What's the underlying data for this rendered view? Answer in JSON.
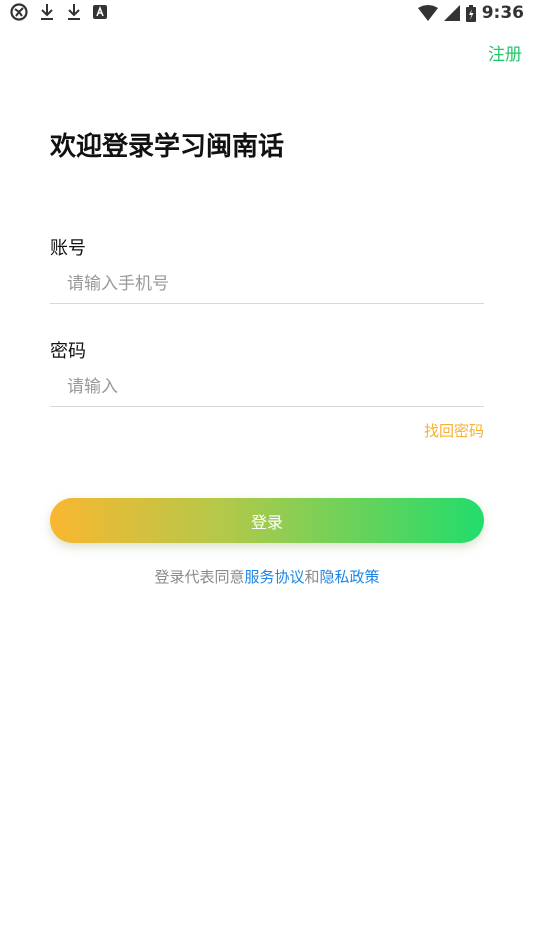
{
  "status_bar": {
    "time": "9:36",
    "left_icons": [
      "vpn-icon",
      "download-icon",
      "download-icon",
      "app-a-icon"
    ],
    "right_icons": [
      "wifi-icon",
      "signal-icon",
      "battery-charging-icon"
    ]
  },
  "header": {
    "register_label": "注册"
  },
  "main": {
    "title": "欢迎登录学习闽南话",
    "account": {
      "label": "账号",
      "placeholder": "请输入手机号",
      "value": ""
    },
    "password": {
      "label": "密码",
      "placeholder": "请输入",
      "value": ""
    },
    "forgot_label": "找回密码",
    "login_label": "登录",
    "agreement": {
      "prefix": "登录代表同意",
      "service_link": "服务协议",
      "joiner": "和",
      "privacy_link": "隐私政策"
    }
  },
  "colors": {
    "accent_green": "#22c768",
    "forgot_orange": "#f7b12e",
    "link_blue": "#1e86e6",
    "gradient_start": "#f9b730",
    "gradient_end": "#22dc6b"
  }
}
